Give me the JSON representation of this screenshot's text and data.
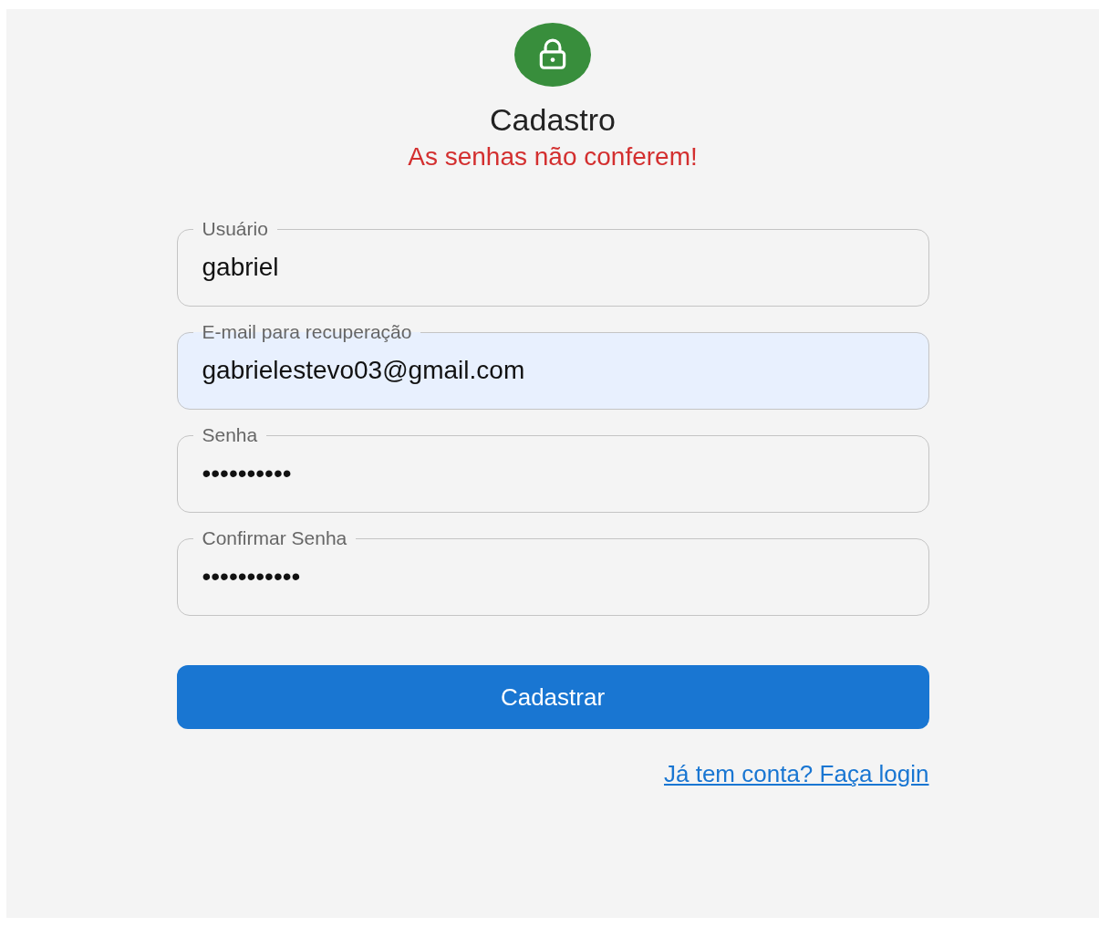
{
  "title": "Cadastro",
  "error": "As senhas não conferem!",
  "fields": [
    {
      "label": "Usuário",
      "value": "gabriel",
      "autofilled": false
    },
    {
      "label": "E-mail para recuperação",
      "value": "gabrielestevo03@gmail.com",
      "autofilled": true
    },
    {
      "label": "Senha",
      "value": "••••••••••",
      "autofilled": false
    },
    {
      "label": "Confirmar Senha",
      "value": "•••••••••••",
      "autofilled": false
    }
  ],
  "submit": "Cadastrar",
  "link": "Já tem conta? Faça login"
}
